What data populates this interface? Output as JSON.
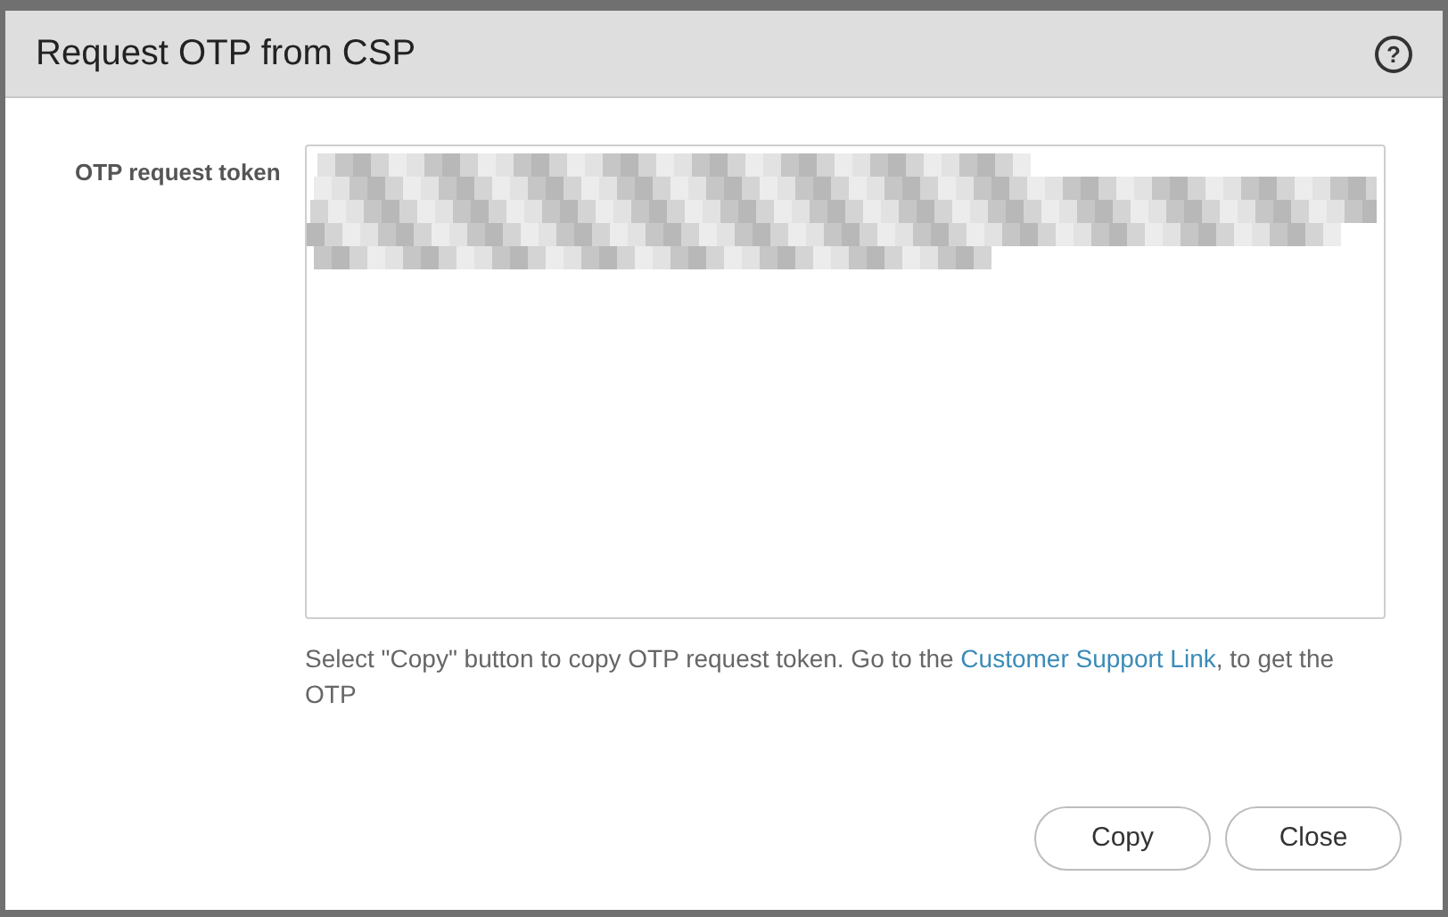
{
  "dialog": {
    "title": "Request OTP from CSP",
    "help_label": "?"
  },
  "field": {
    "label": "OTP request token"
  },
  "hint": "Select \"Copy\" button to copy OTP request token. Go to the ",
  "link": "Customer Support Link",
  "hint_end": ", to get the OTP",
  "buttons": [
    "Copy",
    "Close"
  ]
}
